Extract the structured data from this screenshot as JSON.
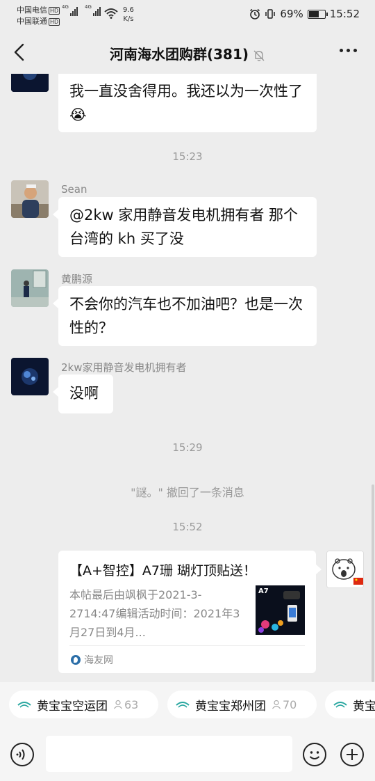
{
  "status_bar": {
    "carrier1": "中国电信",
    "carrier2": "中国联通",
    "hd_badge": "HD",
    "network1": "4G",
    "network2": "4G",
    "net_speed_value": "9.6",
    "net_speed_unit": "K/s",
    "battery_percent": "69%",
    "battery_level": 0.69,
    "time": "15:52"
  },
  "header": {
    "back_icon": "chevron-left-icon",
    "title": "河南海水团购群(381)",
    "mute_icon": "bell-mute-icon",
    "more_icon": "ellipsis-icon"
  },
  "messages": {
    "m1_text": "我一直没舍得用。我还以为一次性了",
    "m1_emoji": "😭",
    "ts1": "15:23",
    "m2_sender": "Sean",
    "m2_text": "@2kw 家用静音发电机拥有者  那个台湾的 kh 买了没",
    "m3_sender": "黄鹏源",
    "m3_text": "不会你的汽车也不加油吧？也是一次性的？",
    "m4_sender": "2kw家用静音发电机拥有者",
    "m4_text": "没啊",
    "ts2": "15:29",
    "recall": "\"謎。\" 撤回了一条消息",
    "ts3": "15:52",
    "card_title": "【A+智控】A7珊 瑚灯顶贴送！",
    "card_desc": "本帖最后由飒枫于2021-3-2714:47编辑活动时间：2021年3月27日到4月...",
    "card_thumb_label": "A7",
    "card_source": "海友网"
  },
  "chips": [
    {
      "label": "黄宝宝空运团",
      "count": "63"
    },
    {
      "label": "黄宝宝郑州团",
      "count": "70"
    },
    {
      "label": "黄宝"
    }
  ],
  "input": {
    "voice_icon": "voice-icon",
    "emoji_icon": "emoji-icon",
    "plus_icon": "plus-icon"
  },
  "colors": {
    "background": "#ededed",
    "bubble": "#ffffff",
    "timestamp": "#999999"
  }
}
